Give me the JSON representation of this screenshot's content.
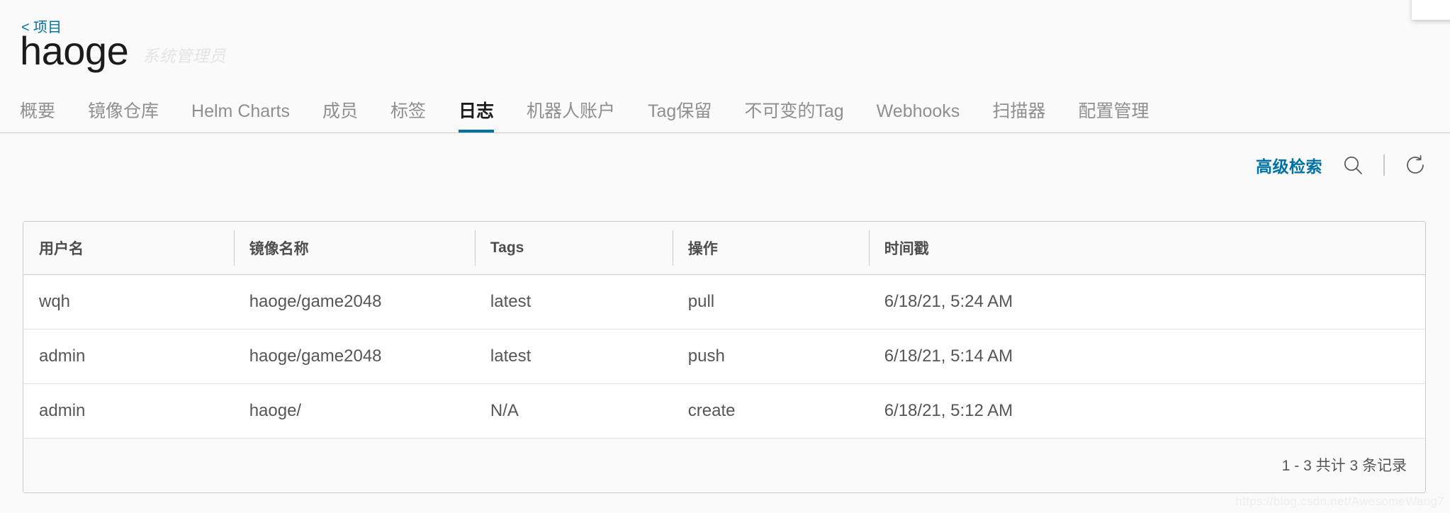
{
  "header": {
    "breadcrumb_chevron": "<",
    "breadcrumb_label": "项目",
    "project_name": "haoge",
    "project_role": "系统管理员"
  },
  "tabs": [
    {
      "label": "概要",
      "active": false
    },
    {
      "label": "镜像仓库",
      "active": false
    },
    {
      "label": "Helm Charts",
      "active": false
    },
    {
      "label": "成员",
      "active": false
    },
    {
      "label": "标签",
      "active": false
    },
    {
      "label": "日志",
      "active": true
    },
    {
      "label": "机器人账户",
      "active": false
    },
    {
      "label": "Tag保留",
      "active": false
    },
    {
      "label": "不可变的Tag",
      "active": false
    },
    {
      "label": "Webhooks",
      "active": false
    },
    {
      "label": "扫描器",
      "active": false
    },
    {
      "label": "配置管理",
      "active": false
    }
  ],
  "toolbar": {
    "advanced_search_label": "高级检索",
    "search_icon": "search-icon",
    "refresh_icon": "refresh-icon"
  },
  "table": {
    "columns": [
      "用户名",
      "镜像名称",
      "Tags",
      "操作",
      "时间戳"
    ],
    "rows": [
      {
        "username": "wqh",
        "repository": "haoge/game2048",
        "tags": "latest",
        "operation": "pull",
        "timestamp": "6/18/21, 5:24 AM"
      },
      {
        "username": "admin",
        "repository": "haoge/game2048",
        "tags": "latest",
        "operation": "push",
        "timestamp": "6/18/21, 5:14 AM"
      },
      {
        "username": "admin",
        "repository": "haoge/",
        "tags": "N/A",
        "operation": "create",
        "timestamp": "6/18/21, 5:12 AM"
      }
    ],
    "pagination_label": "1 - 3 共计 3 条记录"
  },
  "watermark": "https://blog.csdn.net/AwesomeWang7",
  "colors": {
    "accent": "#0072a3",
    "text": "#565656",
    "border": "#cccccc",
    "page_bg": "#fafafa"
  }
}
